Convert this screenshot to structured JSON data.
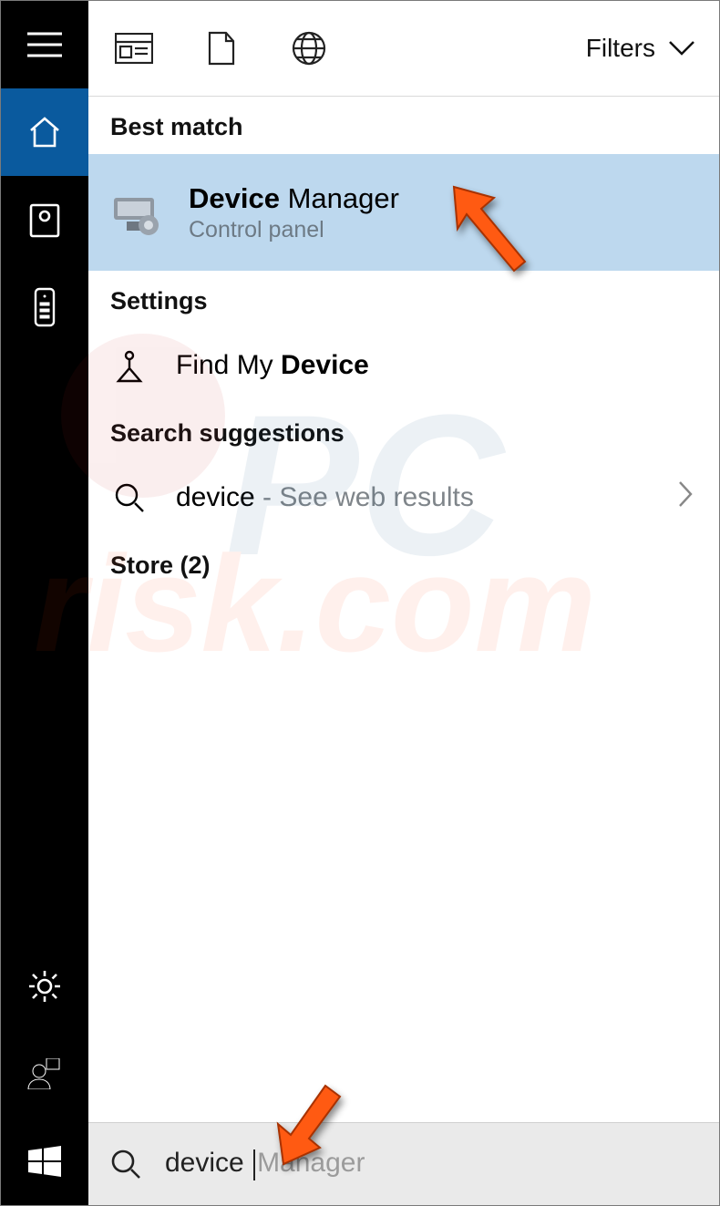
{
  "toolbar": {
    "filters_label": "Filters"
  },
  "sections": {
    "best_match": "Best match",
    "settings": "Settings",
    "suggestions": "Search suggestions",
    "store": "Store (2)"
  },
  "result": {
    "title_bold": "Device",
    "title_rest": " Manager",
    "subtitle": "Control panel"
  },
  "settings_item": {
    "prefix": "Find My ",
    "bold": "Device"
  },
  "suggestion": {
    "term": "device",
    "hint": " - See web results"
  },
  "search": {
    "typed": "device ",
    "ghost": "Manager"
  },
  "watermark": {
    "line1": "PC",
    "line2": "risk.com"
  }
}
